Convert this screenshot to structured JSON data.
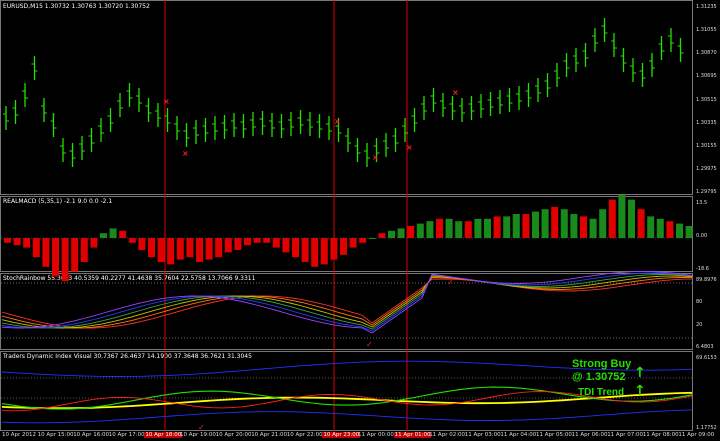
{
  "main_pane": {
    "title": "EURUSD,M15  1.30732 1.30763 1.30720 1.30752",
    "price_labels": [
      "1.31235",
      "1.31055",
      "1.30870",
      "1.30695",
      "1.30515",
      "1.30335",
      "1.30155",
      "1.29975",
      "1.29795"
    ],
    "current_price_label": "1.30752"
  },
  "macd_pane": {
    "title": "REALMACD (5,35,1) -2.1 9.0 0.0 -2.1",
    "labels": [
      "13.5",
      "0.00",
      "-18.6"
    ]
  },
  "stoch_pane": {
    "title": "StochRainbow 55.3623 40.5359 40.2277 41.4638 35.7604 22.5758 13.7066 9.3311",
    "labels": [
      "89.8976",
      "80",
      "20",
      "6.4803"
    ]
  },
  "tdi_pane": {
    "title": "Traders Dynamic Index Visual 30.7367 26.4637 14.1900 37.3648 36.7621 31.3045",
    "labels": [
      "69.6153",
      "1.17752"
    ],
    "signal_line1": "Strong Buy",
    "signal_line2": "@ 1.30752",
    "signal_line3": "TDI Trend",
    "arrow_up": "↑",
    "arrow_down": "↓"
  },
  "time_axis": [
    {
      "label": "10 Apr 2012",
      "hl": false
    },
    {
      "label": "10 Apr 15:00",
      "hl": false
    },
    {
      "label": "10 Apr 16:00",
      "hl": false
    },
    {
      "label": "10 Apr 17:00",
      "hl": false
    },
    {
      "label": "10 Apr 18:00",
      "hl": true
    },
    {
      "label": "10 Apr 19:00",
      "hl": false
    },
    {
      "label": "10 Apr 20:00",
      "hl": false
    },
    {
      "label": "10 Apr 21:00",
      "hl": false
    },
    {
      "label": "10 Apr 22:00",
      "hl": false
    },
    {
      "label": "10 Apr 23:00",
      "hl": true
    },
    {
      "label": "11 Apr 00:00",
      "hl": false
    },
    {
      "label": "11 Apr 01:00",
      "hl": true
    },
    {
      "label": "11 Apr 02:00",
      "hl": false
    },
    {
      "label": "11 Apr 03:00",
      "hl": false
    },
    {
      "label": "11 Apr 04:00",
      "hl": false
    },
    {
      "label": "11 Apr 05:00",
      "hl": false
    },
    {
      "label": "11 Apr 06:00",
      "hl": false
    },
    {
      "label": "11 Apr 07:00",
      "hl": false
    },
    {
      "label": "11 Apr 08:00",
      "hl": false
    },
    {
      "label": "11 Apr 09:00",
      "hl": false
    }
  ],
  "colors": {
    "candle": "#22e000",
    "vline": "#e00000",
    "macd_pos": "#1a8a1a",
    "macd_neg": "#e00000",
    "macd_hi": "#e00000",
    "tdi_yellow": "#ffff00",
    "tdi_green": "#22e000",
    "tdi_blue": "#2030ff"
  },
  "icons": {
    "marker_cross": "red-x-marker",
    "marker_check": "red-check-marker"
  }
}
